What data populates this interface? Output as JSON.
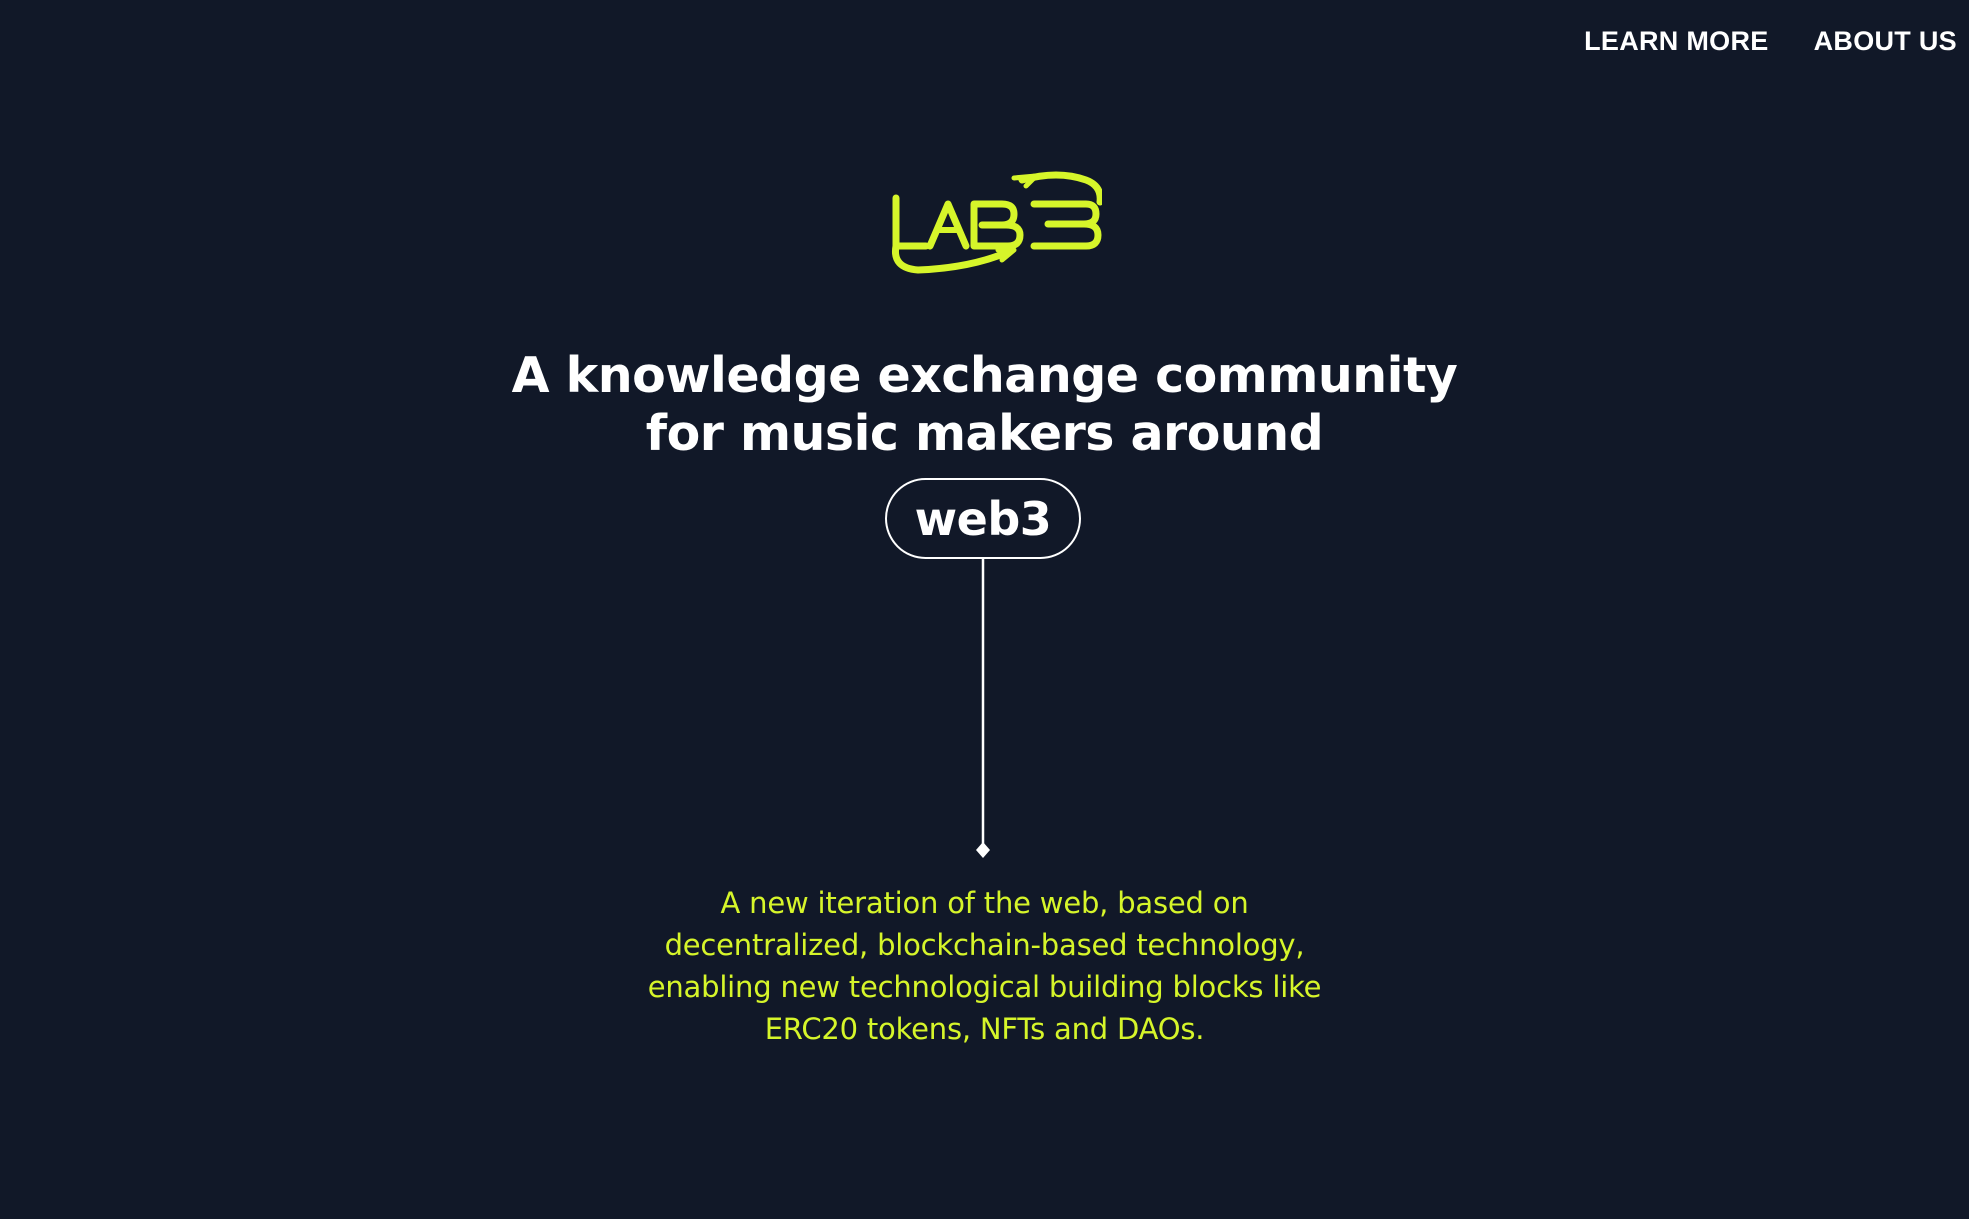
{
  "nav": {
    "items": [
      {
        "label": "LEARN MORE"
      },
      {
        "label": "ABOUT US"
      }
    ]
  },
  "logo": {
    "text": "LAB3",
    "color": "#d6f52a"
  },
  "hero": {
    "headline_lines": [
      "A knowledge exchange community",
      "for music makers around"
    ],
    "term": "web3",
    "definition_lines": [
      "A new iteration of the web, based on",
      "decentralized, blockchain-based technology,",
      "enabling new technological building blocks like",
      "ERC20 tokens, NFTs and DAOs."
    ]
  },
  "colors": {
    "background": "#111828",
    "accent": "#d6f52a",
    "text": "#ffffff"
  }
}
